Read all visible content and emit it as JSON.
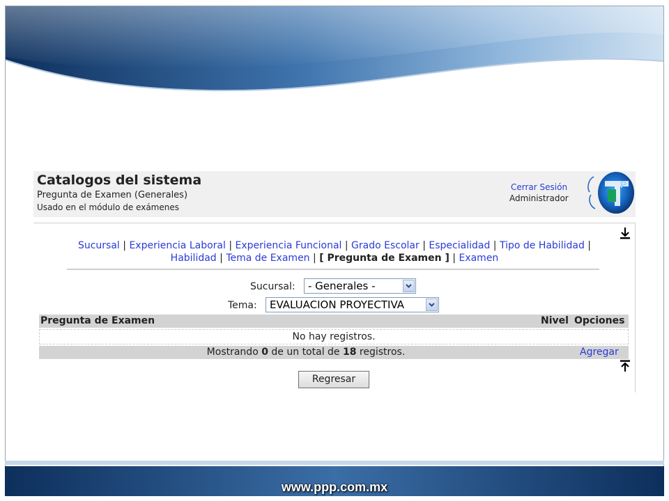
{
  "header": {
    "title": "Catalogos del sistema",
    "subtitle": "Pregunta de Examen (Generales)",
    "description": "Usado en el módulo de exámenes",
    "logout_label": "Cerrar Sesión",
    "user_role": "Administrador"
  },
  "nav": {
    "items": [
      {
        "label": "Sucursal"
      },
      {
        "label": "Experiencia Laboral"
      },
      {
        "label": "Experiencia Funcional"
      },
      {
        "label": "Grado Escolar"
      },
      {
        "label": "Especialidad"
      },
      {
        "label": "Tipo de Habilidad"
      },
      {
        "label": "Habilidad"
      },
      {
        "label": "Tema de Examen"
      },
      {
        "label": "[ Pregunta de Examen ]",
        "current": true
      },
      {
        "label": "Examen"
      }
    ],
    "separator": "|"
  },
  "filters": {
    "sucursal_label": "Sucursal:",
    "sucursal_value": "- Generales -",
    "tema_label": "Tema:",
    "tema_value": "EVALUACION PROYECTIVA"
  },
  "grid": {
    "columns": [
      "Pregunta de Examen",
      "Nivel",
      "Opciones"
    ],
    "empty_text": "No hay registros.",
    "footer_prefix": "Mostrando",
    "shown_count": "0",
    "footer_middle": "de un total de",
    "total_count": "18",
    "footer_suffix": "registros.",
    "add_label": "Agregar"
  },
  "actions": {
    "back_label": "Regresar"
  },
  "footer": {
    "url": "www.ppp.com.mx"
  },
  "icons": {
    "scroll_bottom": "arrow-down-to-line-icon",
    "scroll_top": "arrow-up-to-line-icon",
    "logo": "ppp-logo",
    "select_arrow": "chevron-down-icon"
  },
  "colors": {
    "link": "#2a3ad6",
    "header_bg": "#f0f0f0",
    "grid_header_bg": "#d3d3d3",
    "slide_blue": "#1f4f86"
  }
}
